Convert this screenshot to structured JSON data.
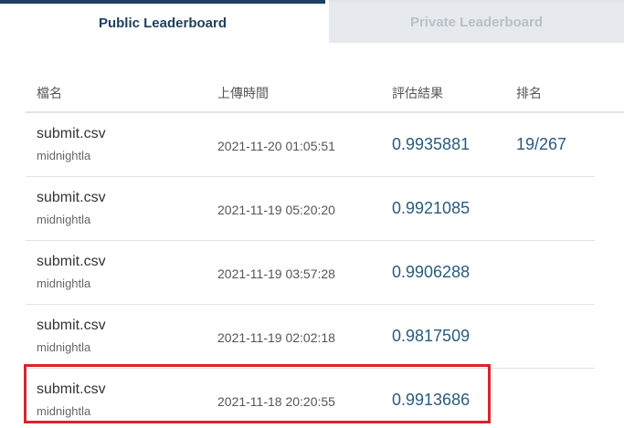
{
  "tabs": {
    "public": "Public Leaderboard",
    "private": "Private Leaderboard"
  },
  "table": {
    "headers": {
      "file": "檔名",
      "upload_time": "上傳時間",
      "result": "評估結果",
      "rank": "排名"
    },
    "rows": [
      {
        "file": "submit.csv",
        "user": "midnightla",
        "time": "2021-11-20 01:05:51",
        "score": "0.9935881",
        "rank": "19/267"
      },
      {
        "file": "submit.csv",
        "user": "midnightla",
        "time": "2021-11-19 05:20:20",
        "score": "0.9921085",
        "rank": ""
      },
      {
        "file": "submit.csv",
        "user": "midnightla",
        "time": "2021-11-19 03:57:28",
        "score": "0.9906288",
        "rank": ""
      },
      {
        "file": "submit.csv",
        "user": "midnightla",
        "time": "2021-11-19 02:02:18",
        "score": "0.9817509",
        "rank": ""
      },
      {
        "file": "submit.csv",
        "user": "midnightla",
        "time": "2021-11-18 20:20:55",
        "score": "0.9913686",
        "rank": ""
      }
    ]
  },
  "colors": {
    "active_tab": "#1c3f5e",
    "score": "#2a5b7e",
    "highlight": "#d9242b"
  }
}
